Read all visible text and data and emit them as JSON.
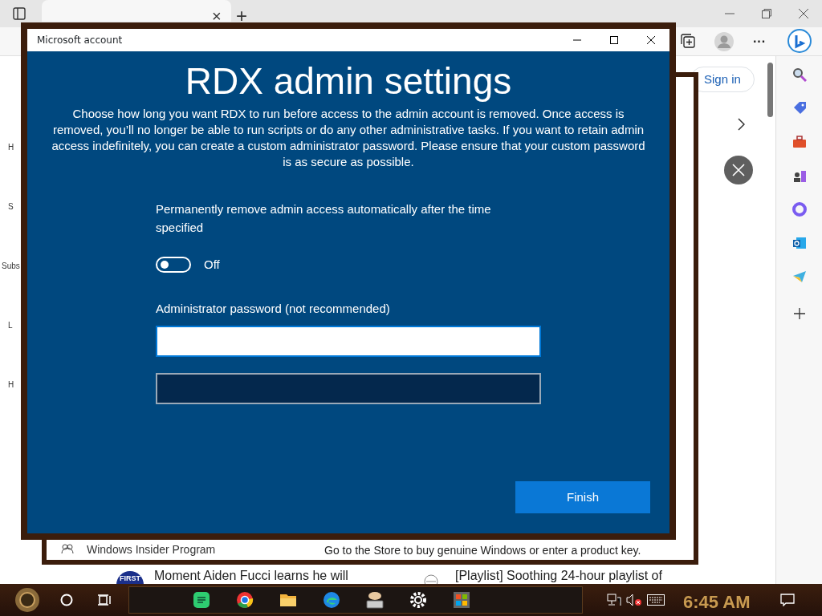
{
  "browser": {
    "tab_close": "×",
    "new_tab": "+",
    "menu": "···",
    "sign_in": "Sign in",
    "left_fragments": [
      "H",
      "S",
      "Subs",
      "L",
      "H"
    ],
    "feed": [
      {
        "logo": "FIRST",
        "text": "Moment Aiden Fucci learns he will"
      },
      {
        "text": "[Playlist] Soothing 24-hour playlist of"
      }
    ],
    "panel": {
      "item": "Windows Insider Program",
      "note": "Go to the Store to buy genuine Windows or enter a product key."
    }
  },
  "dialog": {
    "title": "Microsoft account",
    "heading": "RDX admin settings",
    "description": "Choose how long you want RDX to run before access to the admin account is removed. Once access is removed, you’ll no longer be able to run scripts or do any other administrative tasks. If you want to retain admin access indefinitely, you can create a custom administrator password. Please ensure that your custom password is as secure as possible.",
    "toggle": {
      "label": "Permanently remove admin access automatically after the time specified",
      "on": false,
      "state_text": "Off"
    },
    "password_label": "Administrator password (not recommended)",
    "fields": [
      {
        "focused": true
      },
      {
        "focused": false
      }
    ],
    "finish": "Finish"
  },
  "taskbar": {
    "apps": [
      {
        "kind": "music"
      },
      {
        "kind": "chrome"
      },
      {
        "kind": "folder"
      },
      {
        "kind": "edge"
      },
      {
        "kind": "keyboard"
      },
      {
        "kind": "settings"
      },
      {
        "kind": "store"
      }
    ],
    "clock": "6:45 AM"
  }
}
